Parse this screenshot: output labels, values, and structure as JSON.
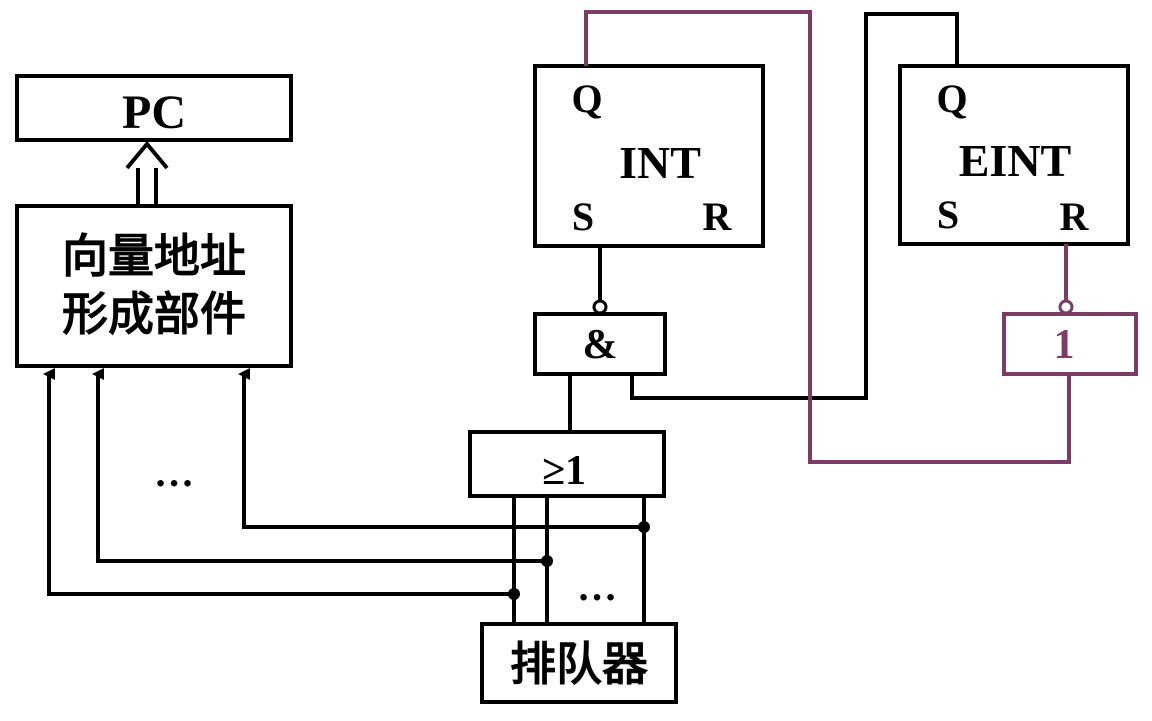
{
  "colors": {
    "line": "#000000",
    "reset_path": "#7b3d68",
    "background": "#ffffff"
  },
  "blocks": {
    "pc": "PC",
    "vector_line1": "向量地址",
    "vector_line2": "形成部件",
    "int": {
      "q": "Q",
      "name": "INT",
      "s": "S",
      "r": "R"
    },
    "eint": {
      "q": "Q",
      "name": "EINT",
      "s": "S",
      "r": "R"
    },
    "and_gate": "&",
    "or_gate": "≥1",
    "not_gate": "1",
    "queuer": "排队器"
  },
  "ellipsis": {
    "left": "…",
    "bottom": "…"
  }
}
